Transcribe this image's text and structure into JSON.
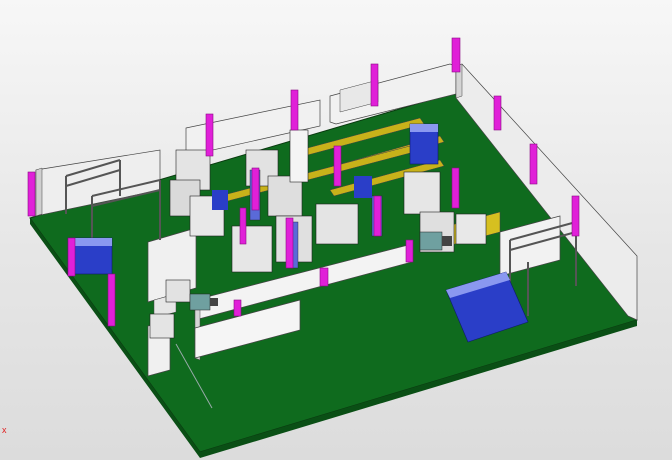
{
  "view": {
    "corner_mark": "x"
  },
  "colors": {
    "background": "#e2e2e2",
    "floor_top": "#0f6b1e",
    "floor_side": "#0a4f15",
    "wall_light": "#f1f1f1",
    "wall_shade": "#cfcfcf",
    "column": "#e020d8",
    "column_dark": "#a0109a",
    "drum": "#2a3ec8",
    "drum_top": "#8a98f0",
    "machine": "#e4e4e4",
    "machine_dark": "#9a9a9a",
    "conveyor": "#c8b21a",
    "gantry": "#7a7a7a",
    "outline": "#1a1a1a",
    "mark": "#e02020"
  }
}
